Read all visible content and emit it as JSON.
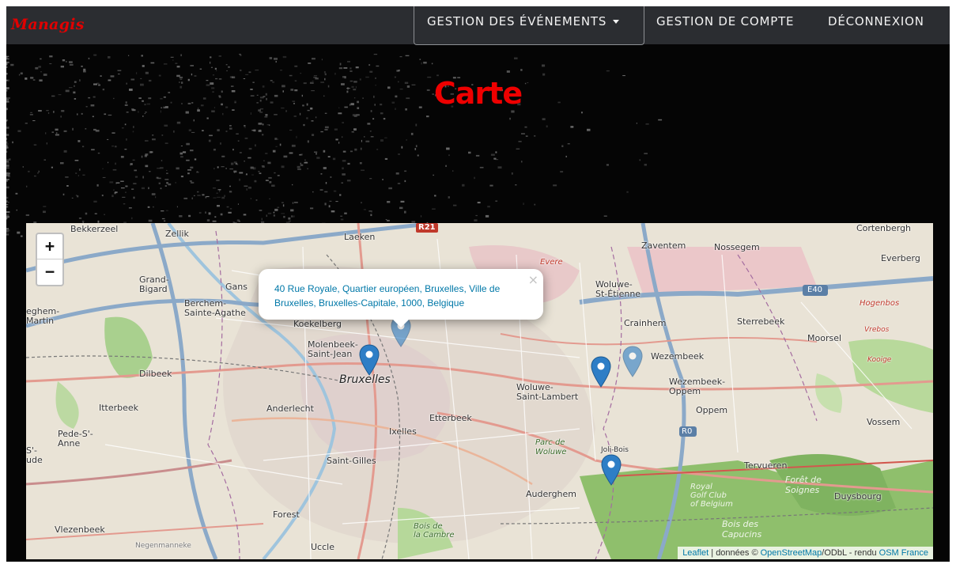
{
  "navbar": {
    "brand": "Managis",
    "items": [
      {
        "label": "GESTION DES ÉVÉNEMENTS"
      },
      {
        "label": "GESTION DE COMPTE"
      },
      {
        "label": "DÉCONNEXION"
      }
    ]
  },
  "page": {
    "title": "Carte"
  },
  "map": {
    "zoom_in": "+",
    "zoom_out": "−",
    "popup": {
      "text": "40 Rue Royale, Quartier européen, Bruxelles, Ville de Bruxelles, Bruxelles-Capitale, 1000, Belgique",
      "close": "×"
    },
    "labels": {
      "bekkerzeel": "Bekkerzeel",
      "zellik": "Zellik",
      "laeken": "Laeken",
      "r21": "R21",
      "evere": "Evere",
      "zaventem": "Zaventem",
      "nossegem": "Nossegem",
      "cortenbergh": "Cortenbergh",
      "everberg": "Everberg",
      "grand_bigard": "Grand-\nBigard",
      "gans": "Gans",
      "berchem": "Berchem-\nSainte-Agathe",
      "woluwe_st_etienne": "Woluwe-\nSt-Étienne",
      "e40": "E40",
      "hogenbos": "Hogenbos",
      "ghem_martin": "eghem-\nMartin",
      "koekelberg": "Koekelberg",
      "crainhem": "Crainhem",
      "sterrebeek": "Sterrebeek",
      "moorsel": "Moorsel",
      "molenbeek": "Molenbeek-\nSaint-Jean",
      "wezembeek": "Wezembeek",
      "dilbeek": "Dilbeek",
      "bruxelles": "Bruxelles",
      "wezembeek_oppem": "Wezembeek-\nOppem",
      "oppem": "Oppem",
      "woluwe_st_lambert": "Woluwe-\nSaint-Lambert",
      "itterbeek": "Itterbeek",
      "anderlecht": "Anderlecht",
      "etterbeek": "Etterbeek",
      "ixelles": "Ixelles",
      "r0": "R0",
      "vossem": "Vossem",
      "pede": "Pede-S'-\nAnne",
      "parc_woluwe": "Parc de\nWoluwe",
      "joli_bois": "Joli-Bois",
      "tervueren": "Tervueren",
      "foret": "Forêt de\nSoignes",
      "duysbourg": "Duysbourg",
      "saint_gilles": "Saint-Gilles",
      "auderghem": "Auderghem",
      "royal_golf": "Royal\nGolf Club\nof Belgium",
      "forest": "Forest",
      "bois_capucins": "Bois des\nCapucins",
      "vlezenbeek": "Vlezenbeek",
      "negenmanneke": "Negenmanneke",
      "bois_cambre": "Bois de\nla Cambre",
      "uccle": "Uccle",
      "sainte": "S'-\nude",
      "vrebos": "Vrebos",
      "kooige": "Kooige"
    },
    "attribution": {
      "leaflet": "Leaflet",
      "data_text": " | données © ",
      "osm": "OpenStreetMap",
      "odbl": "/ODbL - rendu ",
      "osm_france": "OSM France"
    }
  },
  "colors": {
    "navbar_bg": "#2b2d31",
    "brand": "#e10000",
    "title": "#ee0000",
    "marker": "#2e7ec6"
  }
}
